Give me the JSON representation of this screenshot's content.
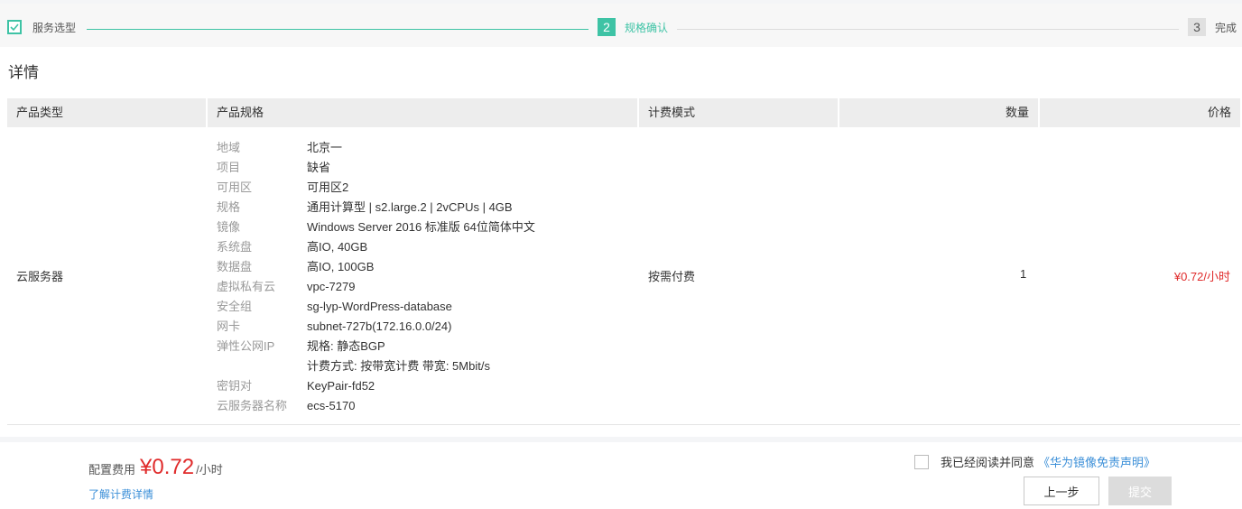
{
  "stepper": {
    "steps": [
      {
        "label": "服务选型"
      },
      {
        "num": "2",
        "label": "规格确认"
      },
      {
        "num": "3",
        "label": "完成"
      }
    ]
  },
  "details": {
    "title": "详情",
    "columns": [
      "产品类型",
      "产品规格",
      "计费模式",
      "数量",
      "价格"
    ],
    "row": {
      "type": "云服务器",
      "billing": "按需付费",
      "quantity": "1",
      "price": "¥0.72/小时",
      "specs": [
        {
          "k": "地域",
          "v": "北京一"
        },
        {
          "k": "项目",
          "v": "缺省"
        },
        {
          "k": "可用区",
          "v": "可用区2"
        },
        {
          "k": "规格",
          "v": "通用计算型 | s2.large.2 | 2vCPUs | 4GB"
        },
        {
          "k": "镜像",
          "v": "Windows Server 2016 标准版 64位简体中文"
        },
        {
          "k": "系统盘",
          "v": "高IO, 40GB"
        },
        {
          "k": "数据盘",
          "v": "高IO, 100GB"
        },
        {
          "k": "虚拟私有云",
          "v": "vpc-7279"
        },
        {
          "k": "安全组",
          "v": "sg-lyp-WordPress-database"
        },
        {
          "k": "网卡",
          "v": "subnet-727b(172.16.0.0/24)"
        },
        {
          "k": "弹性公网IP",
          "v": "规格: 静态BGP"
        },
        {
          "k": "",
          "v": "计费方式: 按带宽计费 带宽: 5Mbit/s"
        },
        {
          "k": "密钥对",
          "v": "KeyPair-fd52"
        },
        {
          "k": "云服务器名称",
          "v": "ecs-5170"
        }
      ]
    }
  },
  "footer": {
    "fee_label": "配置费用",
    "fee_amount": "¥0.72",
    "fee_unit": "/小时",
    "fee_link": "了解计费详情",
    "agree_text": "我已经阅读并同意",
    "agree_link": "《华为镜像免责声明》",
    "prev_label": "上一步",
    "submit_label": "提交"
  },
  "colors": {
    "accent": "#3ec3a5",
    "price": "#e02b2b",
    "link": "#3b8fd8"
  }
}
